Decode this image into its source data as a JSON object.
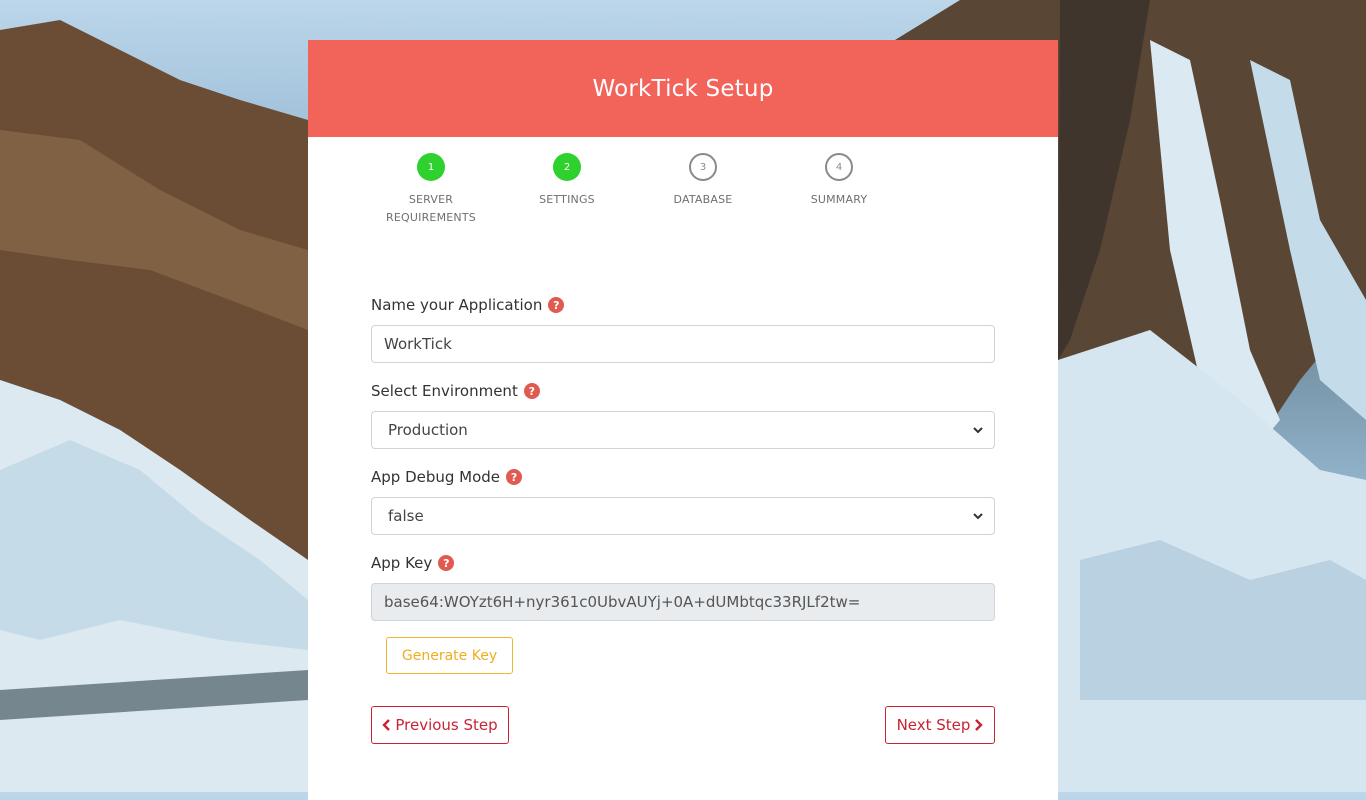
{
  "header": {
    "title": "WorkTick Setup"
  },
  "steps": [
    {
      "number": "1",
      "label_line1": "SERVER",
      "label_line2": "REQUIREMENTS",
      "state": "done"
    },
    {
      "number": "2",
      "label_line1": "SETTINGS",
      "label_line2": "",
      "state": "done"
    },
    {
      "number": "3",
      "label_line1": "DATABASE",
      "label_line2": "",
      "state": "todo"
    },
    {
      "number": "4",
      "label_line1": "SUMMARY",
      "label_line2": "",
      "state": "todo"
    }
  ],
  "form": {
    "app_name": {
      "label": "Name your Application",
      "value": "WorkTick"
    },
    "environment": {
      "label": "Select Environment",
      "value": "Production"
    },
    "debug": {
      "label": "App Debug Mode",
      "value": "false"
    },
    "app_key": {
      "label": "App Key",
      "value": "base64:WOYzt6H+nyr361c0UbvAUYj+0A+dUMbtqc33RJLf2tw="
    }
  },
  "buttons": {
    "generate_key": "Generate Key",
    "previous": "Previous Step",
    "next": "Next Step"
  },
  "icons": {
    "help": "question-circle-icon",
    "chevron_left": "chevron-left-icon",
    "chevron_right": "chevron-right-icon",
    "select_arrow": "chevron-down-icon"
  },
  "colors": {
    "header_bg": "#f2635a",
    "step_done": "#2ed12e",
    "help_icon": "#e05a52",
    "nav_button": "#c82333",
    "generate_button": "#f0ad1f"
  }
}
